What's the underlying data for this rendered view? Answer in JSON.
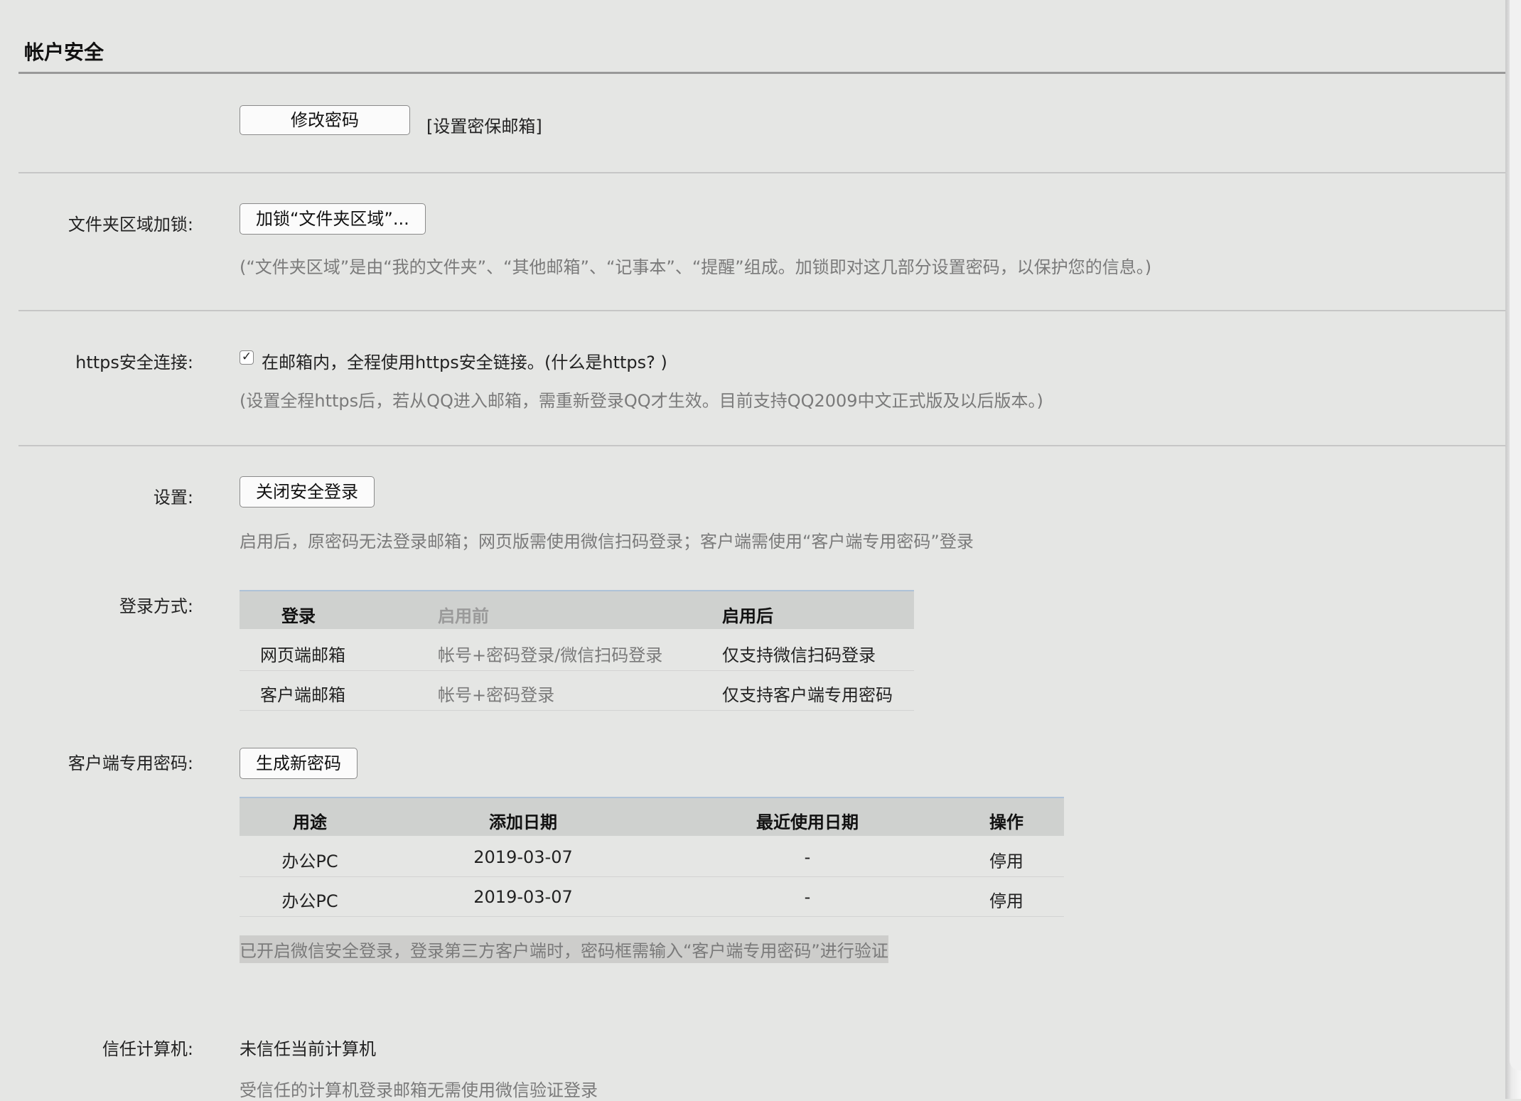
{
  "section": {
    "title": "帐户安全"
  },
  "password": {
    "change_button": "修改密码",
    "set_email_link": "[设置密保邮箱]"
  },
  "folder_lock": {
    "label": "文件夹区域加锁:",
    "button": "加锁“文件夹区域”...",
    "hint": "(“文件夹区域”是由“我的文件夹”、“其他邮箱”、“记事本”、“提醒”组成。加锁即对这几部分设置密码，以保护您的信息。)"
  },
  "https": {
    "label": "https安全连接:",
    "checkbox_checked": true,
    "checkbox_text": "在邮箱内，全程使用https安全链接。",
    "what_link": "(什么是https? )",
    "hint": "(设置全程https后，若从QQ进入邮箱，需重新登录QQ才生效。目前支持QQ2009中文正式版及以后版本。)"
  },
  "secure_login": {
    "label": "设置:",
    "button": "关闭安全登录",
    "hint": "启用后，原密码无法登录邮箱；网页版需使用微信扫码登录；客户端需使用“客户端专用密码”登录"
  },
  "login_methods": {
    "label": "登录方式:",
    "headers": [
      "登录",
      "启用前",
      "启用后"
    ],
    "rows": [
      [
        "网页端邮箱",
        "帐号+密码登录/微信扫码登录",
        "仅支持微信扫码登录"
      ],
      [
        "客户端邮箱",
        "帐号+密码登录",
        "仅支持客户端专用密码"
      ]
    ]
  },
  "client_password": {
    "label": "客户端专用密码:",
    "button": "生成新密码",
    "headers": [
      "用途",
      "添加日期",
      "最近使用日期",
      "操作"
    ],
    "rows": [
      [
        "办公PC",
        "2019-03-07",
        "-",
        "停用"
      ],
      [
        "办公PC",
        "2019-03-07",
        "-",
        "停用"
      ]
    ],
    "note": "已开启微信安全登录，登录第三方客户端时，密码框需输入“客户端专用密码”进行验证"
  },
  "trusted": {
    "label": "信任计算机:",
    "value": "未信任当前计算机",
    "hint": "受信任的计算机登录邮箱无需使用微信验证登录"
  }
}
